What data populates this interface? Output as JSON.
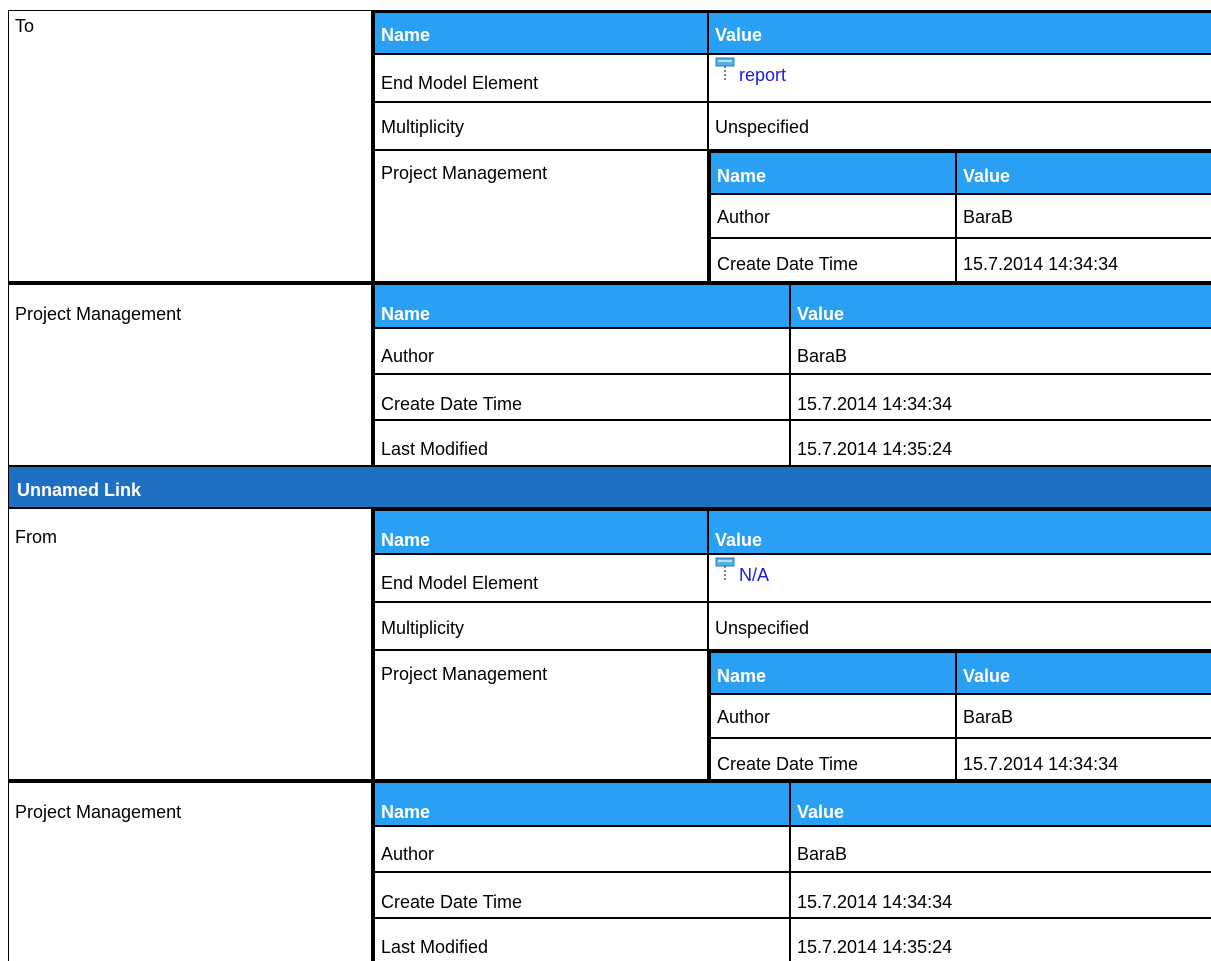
{
  "to_block": {
    "label": "To",
    "header": {
      "name": "Name",
      "value": "Value"
    },
    "end_model_element": {
      "label": "End Model Element",
      "value": "report",
      "icon": "class-pin-icon"
    },
    "multiplicity": {
      "label": "Multiplicity",
      "value": "Unspecified"
    },
    "project_management": {
      "label": "Project Management",
      "header": {
        "name": "Name",
        "value": "Value"
      },
      "author": {
        "label": "Author",
        "value": "BaraB"
      },
      "create": {
        "label": "Create Date Time",
        "value": "15.7.2014 14:34:34"
      }
    }
  },
  "pm1": {
    "label": "Project Management",
    "header": {
      "name": "Name",
      "value": "Value"
    },
    "author": {
      "label": "Author",
      "value": "BaraB"
    },
    "create": {
      "label": "Create Date Time",
      "value": "15.7.2014 14:34:34"
    },
    "modified": {
      "label": "Last Modified",
      "value": "15.7.2014 14:35:24"
    }
  },
  "section": {
    "title": "Unnamed Link"
  },
  "from_block": {
    "label": "From",
    "header": {
      "name": "Name",
      "value": "Value"
    },
    "end_model_element": {
      "label": "End Model Element",
      "value": "N/A",
      "icon": "class-pin-icon"
    },
    "multiplicity": {
      "label": "Multiplicity",
      "value": "Unspecified"
    },
    "project_management": {
      "label": "Project Management",
      "header": {
        "name": "Name",
        "value": "Value"
      },
      "author": {
        "label": "Author",
        "value": "BaraB"
      },
      "create": {
        "label": "Create Date Time",
        "value": "15.7.2014 14:34:34"
      }
    }
  },
  "pm2": {
    "label": "Project Management",
    "header": {
      "name": "Name",
      "value": "Value"
    },
    "author": {
      "label": "Author",
      "value": "BaraB"
    },
    "create": {
      "label": "Create Date Time",
      "value": "15.7.2014 14:34:34"
    },
    "modified": {
      "label": "Last Modified",
      "value": "15.7.2014 14:35:24"
    }
  },
  "colors": {
    "header_blue": "#2aa0f5",
    "section_blue": "#1f6fc2",
    "link": "#1a1ae6"
  }
}
